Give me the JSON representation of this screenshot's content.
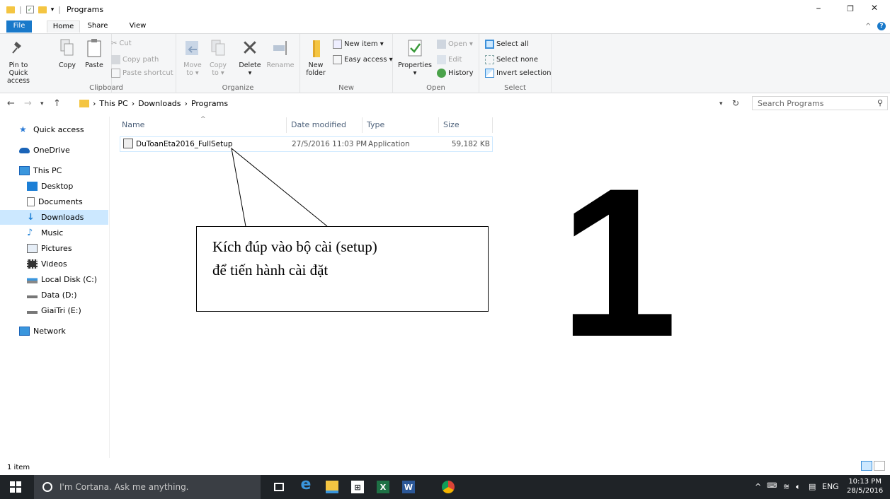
{
  "window": {
    "title": "Programs",
    "minimize": "–",
    "restore": "❐",
    "close": "✕"
  },
  "ribbon_tabs": {
    "file": "File",
    "home": "Home",
    "share": "Share",
    "view": "View",
    "collapse": "^",
    "help": "?"
  },
  "clipboard": {
    "pin": "Pin to Quick access",
    "copy": "Copy",
    "paste": "Paste",
    "cut": "Cut",
    "copy_path": "Copy path",
    "paste_shortcut": "Paste shortcut",
    "label": "Clipboard"
  },
  "organize": {
    "move_to": "Move to ▾",
    "copy_to": "Copy to ▾",
    "delete": "Delete ▾",
    "rename": "Rename",
    "label": "Organize"
  },
  "new": {
    "new_folder": "New folder",
    "new_item": "New item ▾",
    "easy_access": "Easy access ▾",
    "label": "New"
  },
  "open": {
    "properties": "Properties ▾",
    "open": "Open ▾",
    "edit": "Edit",
    "history": "History",
    "label": "Open"
  },
  "select": {
    "select_all": "Select all",
    "select_none": "Select none",
    "invert": "Invert selection",
    "label": "Select"
  },
  "address": {
    "this_pc": "This PC",
    "downloads": "Downloads",
    "programs": "Programs",
    "search_placeholder": "Search Programs"
  },
  "nav": {
    "quick_access": "Quick access",
    "onedrive": "OneDrive",
    "this_pc": "This PC",
    "desktop": "Desktop",
    "documents": "Documents",
    "downloads": "Downloads",
    "music": "Music",
    "pictures": "Pictures",
    "videos": "Videos",
    "local_disk": "Local Disk (C:)",
    "data": "Data (D:)",
    "giaitri": "GiaiTri (E:)",
    "network": "Network"
  },
  "columns": {
    "name": "Name",
    "date": "Date modified",
    "type": "Type",
    "size": "Size"
  },
  "file": {
    "name": "DuToanEta2016_FullSetup",
    "date": "27/5/2016 11:03 PM",
    "type": "Application",
    "size": "59,182 KB"
  },
  "callout": {
    "line1": "Kích đúp vào bộ cài (setup)",
    "line2": "để tiến hành cài đặt"
  },
  "step_number": "1",
  "status": {
    "items": "1 item"
  },
  "taskbar": {
    "cortana": "I'm Cortana. Ask me anything.",
    "lang": "ENG",
    "time": "10:13 PM",
    "date": "28/5/2016"
  }
}
